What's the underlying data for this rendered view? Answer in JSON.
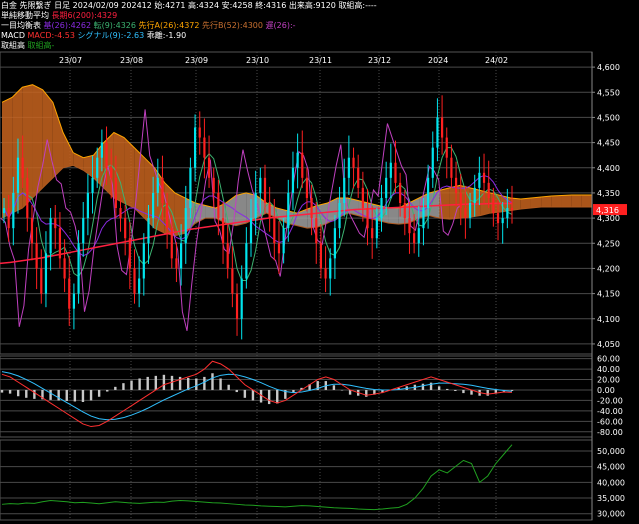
{
  "header": {
    "line1": {
      "instrument": "白金 先限繋ぎ 日足",
      "date": "2024/02/09",
      "session": "202412",
      "open_label": "始:",
      "open": "4271",
      "high_label": "高:",
      "high": "4324",
      "low_label": "安:",
      "low": "4258",
      "close_label": "終:",
      "close": "4316",
      "volume_label": "出来高:",
      "volume": "9120",
      "oi_label": "取組高:",
      "oi": "----"
    },
    "line2": {
      "title": "単純移動平均",
      "ma_label": "長期6(200):",
      "ma_value": "4329"
    },
    "line3": {
      "title": "一目均衡表",
      "base_label": "基(26):",
      "base_value": "4262",
      "conv_label": "転(9):",
      "conv_value": "4326",
      "spanA_label": "先行A(26):",
      "spanA_value": "4372",
      "spanB_label": "先行B(52):",
      "spanB_value": "4300",
      "lag_label": "遅(26):",
      "lag_value": "-"
    },
    "line4": {
      "title": "MACD",
      "macd_label": "MACD:",
      "macd_value": "-4.53",
      "signal_label": "シグナル(9):",
      "signal_value": "-2.63",
      "hist_label": "乖離:",
      "hist_value": "-1.90"
    },
    "line5": {
      "title": "取組高",
      "oi_label": "取組高",
      "oi_value": "-"
    }
  },
  "colors": {
    "background": "#000000",
    "up_candle": "#00e5ee",
    "down_candle": "#ff2020",
    "ma200": "#ff2040",
    "kumo_bull": "#c8641e",
    "kumo_bear": "#a0a0a0",
    "base_line": "#8a2be2",
    "conversion_line": "#3cb371",
    "lagging_span": "#c040c0",
    "span_a": "#ffa500",
    "span_b": "#b05a20",
    "macd_line": "#ff3030",
    "signal_line": "#30c0ff",
    "histogram": "#c8c8c8",
    "oi_line": "#20a020",
    "price_label_bg": "#ff2020"
  },
  "last_price_label": "4,316",
  "chart_data": [
    {
      "type": "candlestick",
      "x_labels": [
        "23/07",
        "23/08",
        "23/09",
        "23/10",
        "23/11",
        "23/12",
        "2024",
        "24/02"
      ],
      "yticks": [
        "4,600",
        "4,550",
        "4,500",
        "4,450",
        "4,400",
        "4,350",
        "4,300",
        "4,250",
        "4,200",
        "4,150",
        "4,100",
        "4,050"
      ],
      "ylim": [
        4030,
        4630
      ],
      "close_series": [
        4320,
        4280,
        4350,
        4420,
        4380,
        4300,
        4250,
        4200,
        4150,
        4230,
        4300,
        4280,
        4220,
        4180,
        4120,
        4150,
        4250,
        4300,
        4350,
        4380,
        4420,
        4450,
        4400,
        4380,
        4320,
        4300,
        4260,
        4200,
        4150,
        4180,
        4250,
        4300,
        4350,
        4380,
        4330,
        4280,
        4220,
        4200,
        4250,
        4320,
        4400,
        4480,
        4460,
        4420,
        4380,
        4350,
        4300,
        4250,
        4200,
        4150,
        4100,
        4180,
        4250,
        4300,
        4350,
        4380,
        4330,
        4300,
        4250,
        4230,
        4280,
        4350,
        4400,
        4430,
        4380,
        4340,
        4300,
        4250,
        4200,
        4180,
        4220,
        4280,
        4330,
        4380,
        4420,
        4400,
        4360,
        4320,
        4280,
        4260,
        4300,
        4340,
        4380,
        4410,
        4370,
        4330,
        4300,
        4270,
        4250,
        4280,
        4320,
        4380,
        4440,
        4500,
        4460,
        4420,
        4380,
        4350,
        4320,
        4300,
        4330,
        4360,
        4390,
        4370,
        4340,
        4310,
        4290,
        4300,
        4320,
        4316
      ],
      "ma200": [
        4210,
        4212,
        4215,
        4218,
        4221,
        4225,
        4229,
        4233,
        4237,
        4241,
        4245,
        4249,
        4253,
        4257,
        4261,
        4265,
        4269,
        4273,
        4277,
        4280,
        4283,
        4286,
        4289,
        4292,
        4295,
        4298,
        4301,
        4303,
        4305,
        4307,
        4309,
        4311,
        4313,
        4315,
        4317,
        4318,
        4319,
        4320,
        4321,
        4322,
        4323,
        4324,
        4325,
        4326,
        4327,
        4328,
        4328,
        4329,
        4329,
        4329
      ],
      "kumo_top": [
        4530,
        4540,
        4560,
        4565,
        4555,
        4530,
        4470,
        4430,
        4420,
        4425,
        4450,
        4470,
        4460,
        4440,
        4420,
        4400,
        4370,
        4350,
        4340,
        4330,
        4325,
        4320,
        4330,
        4345,
        4350,
        4345,
        4330,
        4320,
        4315,
        4310,
        4318,
        4325,
        4330,
        4340,
        4340,
        4335,
        4330,
        4325,
        4320,
        4320,
        4330,
        4340,
        4350,
        4355,
        4360,
        4365,
        4360,
        4355,
        4350,
        4345,
        4340,
        4338,
        4340,
        4342,
        4344,
        4345,
        4346,
        4346,
        4346
      ],
      "kumo_bottom": [
        4300,
        4310,
        4320,
        4340,
        4360,
        4380,
        4400,
        4405,
        4395,
        4380,
        4360,
        4340,
        4330,
        4320,
        4300,
        4280,
        4270,
        4265,
        4270,
        4290,
        4300,
        4300,
        4290,
        4285,
        4290,
        4300,
        4310,
        4300,
        4290,
        4285,
        4280,
        4282,
        4290,
        4300,
        4310,
        4305,
        4300,
        4295,
        4290,
        4288,
        4290,
        4300,
        4305,
        4300,
        4298,
        4300,
        4302,
        4305,
        4310,
        4312,
        4315,
        4318,
        4320,
        4322,
        4322,
        4322,
        4322,
        4322,
        4322
      ]
    },
    {
      "type": "line",
      "name": "MACD",
      "yticks": [
        "60.00",
        "40.00",
        "20.00",
        "0.00",
        "-20.00",
        "-40.00",
        "-60.00",
        "-80.00"
      ],
      "ylim": [
        -90,
        65
      ],
      "macd": [
        30,
        25,
        15,
        5,
        -5,
        -15,
        -25,
        -35,
        -45,
        -55,
        -65,
        -70,
        -68,
        -60,
        -50,
        -40,
        -30,
        -20,
        -10,
        0,
        10,
        15,
        20,
        25,
        30,
        40,
        55,
        50,
        40,
        25,
        10,
        0,
        -10,
        -20,
        -25,
        -20,
        -10,
        0,
        10,
        20,
        25,
        20,
        10,
        0,
        -5,
        -10,
        -8,
        -5,
        0,
        5,
        10,
        15,
        20,
        25,
        20,
        15,
        10,
        5,
        0,
        -5,
        -8,
        -6,
        -4,
        -4.53
      ],
      "signal": [
        35,
        32,
        27,
        20,
        12,
        3,
        -6,
        -15,
        -24,
        -33,
        -42,
        -50,
        -55,
        -57,
        -56,
        -53,
        -48,
        -42,
        -35,
        -27,
        -19,
        -12,
        -5,
        2,
        8,
        15,
        23,
        28,
        30,
        29,
        25,
        20,
        14,
        7,
        1,
        -3,
        -5,
        -4,
        -1,
        3,
        8,
        11,
        11,
        9,
        6,
        3,
        1,
        0,
        0,
        1,
        3,
        5,
        8,
        11,
        13,
        13,
        12,
        11,
        9,
        6,
        3,
        1,
        -1,
        -2.63
      ]
    },
    {
      "type": "line",
      "name": "取組高",
      "yticks": [
        "50,000",
        "45,000",
        "40,000",
        "35,000",
        "30,000"
      ],
      "ylim": [
        28000,
        53500
      ],
      "values": [
        33000,
        33200,
        33100,
        33400,
        33300,
        33800,
        34200,
        34000,
        33800,
        33500,
        33600,
        33400,
        33200,
        33500,
        33800,
        33600,
        33400,
        33300,
        33500,
        33700,
        33600,
        34000,
        34200,
        34100,
        33900,
        33700,
        33500,
        33400,
        33200,
        33000,
        32800,
        32700,
        32500,
        32400,
        32300,
        32200,
        32400,
        32600,
        32500,
        32300,
        32100,
        31900,
        31800,
        31700,
        31500,
        31400,
        31300,
        31500,
        31800,
        32000,
        33000,
        35000,
        38000,
        42000,
        44000,
        43000,
        45000,
        47000,
        46000,
        40000,
        42000,
        46000,
        49000,
        52000
      ]
    }
  ]
}
